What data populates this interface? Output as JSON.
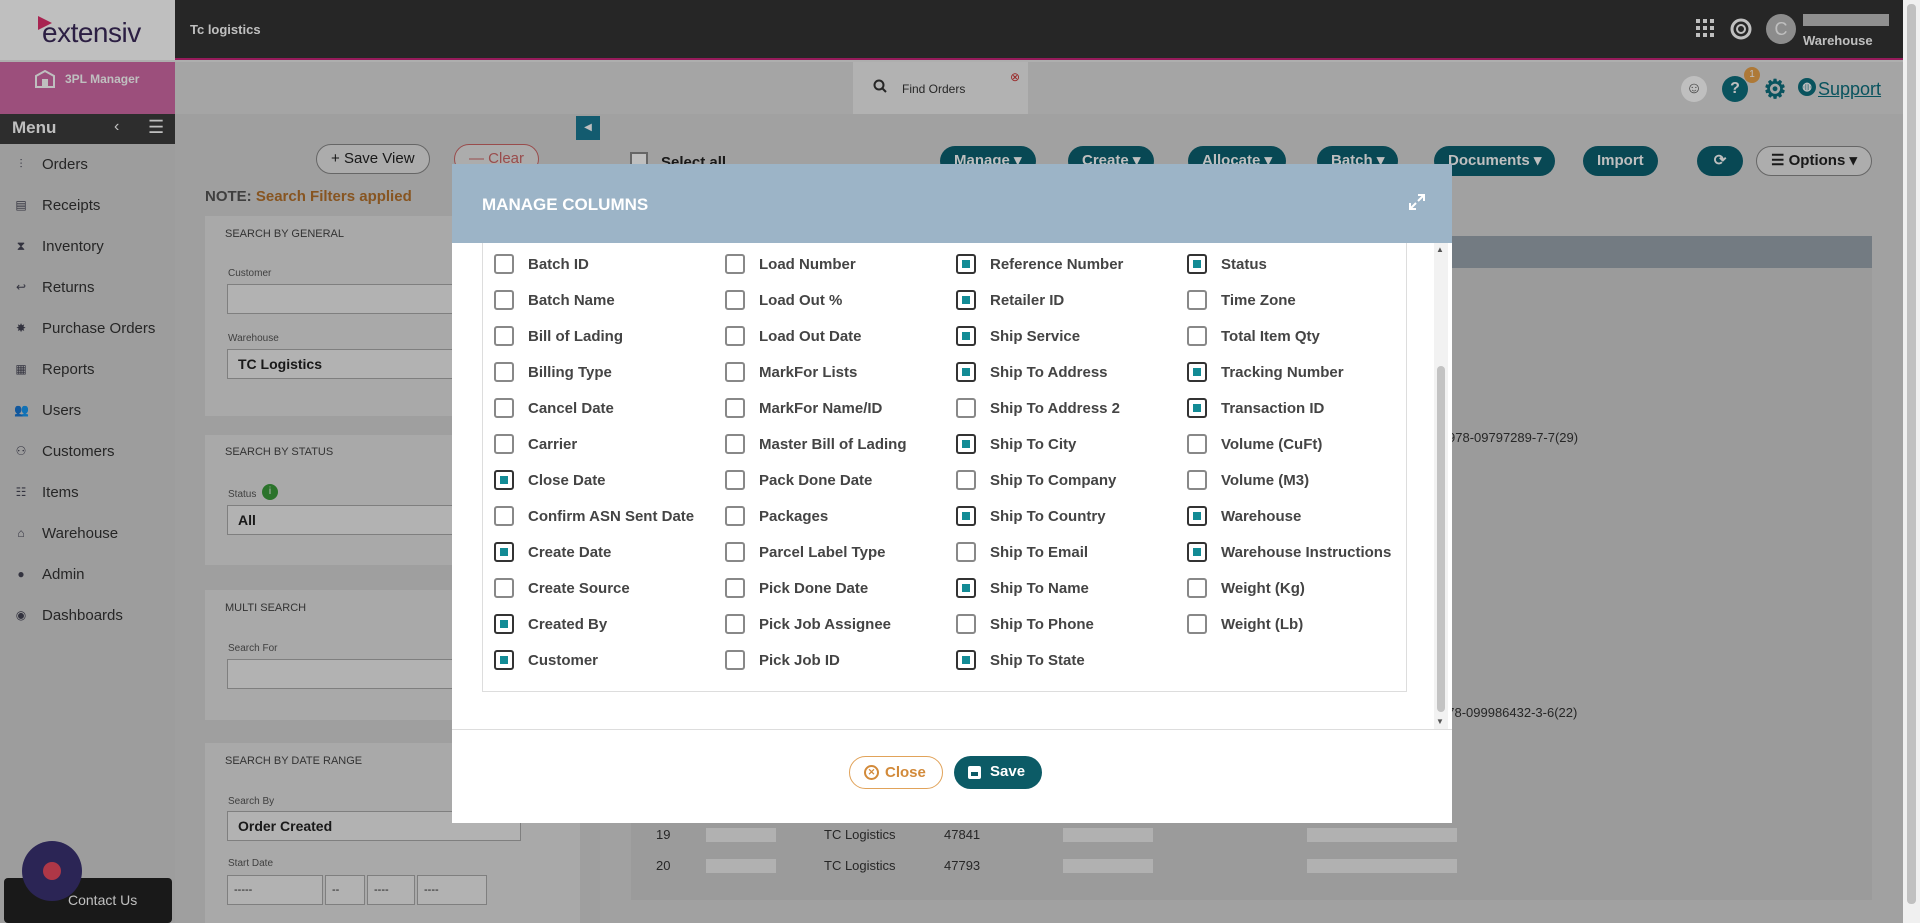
{
  "header": {
    "brand": "extensiv",
    "company": "Tc logistics",
    "user_role": "Warehouse",
    "avatar_initial": "C",
    "icons": [
      "apps-grid-icon",
      "help-wheel-icon"
    ]
  },
  "subheader": {
    "module": "3PL Manager",
    "tab_label": "Find Orders",
    "notification_count": "1",
    "support_label": "Support"
  },
  "sidebar": {
    "title": "Menu",
    "items": [
      {
        "label": "Orders",
        "icon": "orders-icon"
      },
      {
        "label": "Receipts",
        "icon": "receipt-icon"
      },
      {
        "label": "Inventory",
        "icon": "hourglass-icon"
      },
      {
        "label": "Returns",
        "icon": "return-icon"
      },
      {
        "label": "Purchase Orders",
        "icon": "purchase-order-icon"
      },
      {
        "label": "Reports",
        "icon": "reports-icon"
      },
      {
        "label": "Users",
        "icon": "users-icon"
      },
      {
        "label": "Customers",
        "icon": "customers-icon"
      },
      {
        "label": "Items",
        "icon": "items-icon"
      },
      {
        "label": "Warehouse",
        "icon": "warehouse-icon"
      },
      {
        "label": "Admin",
        "icon": "admin-icon"
      },
      {
        "label": "Dashboards",
        "icon": "dashboard-icon"
      }
    ],
    "contact_label": "Contact Us"
  },
  "filters": {
    "save_view": "Save View",
    "clear": "Clear",
    "note_prefix": "NOTE:",
    "note_text": "Search Filters applied",
    "general": {
      "title": "SEARCH BY GENERAL",
      "customer_label": "Customer",
      "warehouse_label": "Warehouse",
      "warehouse_value": "TC Logistics"
    },
    "status": {
      "title": "SEARCH BY STATUS",
      "status_label": "Status",
      "status_value": "All"
    },
    "multi": {
      "title": "MULTI SEARCH",
      "search_for_label": "Search For"
    },
    "date": {
      "title": "SEARCH BY DATE RANGE",
      "search_by_label": "Search By",
      "search_by_value": "Order Created",
      "start_label": "Start Date",
      "start_placeholders": [
        "-----",
        "--",
        "----",
        "----"
      ]
    }
  },
  "grid": {
    "select_all": "Select all",
    "toolbar": [
      "Manage",
      "Create",
      "Allocate",
      "Batch",
      "Documents",
      "Import"
    ],
    "options_label": "Options",
    "partial_ref_1": "978-09797289-7-7(29)",
    "partial_ref_2": "978-099986432-3-6(22)",
    "rows": [
      {
        "num": "19",
        "warehouse": "TC Logistics",
        "id": "47841"
      },
      {
        "num": "20",
        "warehouse": "TC Logistics",
        "id": "47793"
      }
    ]
  },
  "modal": {
    "title": "MANAGE COLUMNS",
    "columns": [
      [
        {
          "label": "Batch ID",
          "checked": false
        },
        {
          "label": "Batch Name",
          "checked": false
        },
        {
          "label": "Bill of Lading",
          "checked": false
        },
        {
          "label": "Billing Type",
          "checked": false
        },
        {
          "label": "Cancel Date",
          "checked": false
        },
        {
          "label": "Carrier",
          "checked": false
        },
        {
          "label": "Close Date",
          "checked": true
        },
        {
          "label": "Confirm ASN Sent Date",
          "checked": false
        },
        {
          "label": "Create Date",
          "checked": true
        },
        {
          "label": "Create Source",
          "checked": false
        },
        {
          "label": "Created By",
          "checked": true
        },
        {
          "label": "Customer",
          "checked": true
        }
      ],
      [
        {
          "label": "Load Number",
          "checked": false
        },
        {
          "label": "Load Out %",
          "checked": false
        },
        {
          "label": "Load Out Date",
          "checked": false
        },
        {
          "label": "MarkFor Lists",
          "checked": false
        },
        {
          "label": "MarkFor Name/ID",
          "checked": false
        },
        {
          "label": "Master Bill of Lading",
          "checked": false
        },
        {
          "label": "Pack Done Date",
          "checked": false
        },
        {
          "label": "Packages",
          "checked": false
        },
        {
          "label": "Parcel Label Type",
          "checked": false
        },
        {
          "label": "Pick Done Date",
          "checked": false
        },
        {
          "label": "Pick Job Assignee",
          "checked": false
        },
        {
          "label": "Pick Job ID",
          "checked": false
        }
      ],
      [
        {
          "label": "Reference Number",
          "checked": true
        },
        {
          "label": "Retailer ID",
          "checked": true
        },
        {
          "label": "Ship Service",
          "checked": true
        },
        {
          "label": "Ship To Address",
          "checked": true
        },
        {
          "label": "Ship To Address 2",
          "checked": false
        },
        {
          "label": "Ship To City",
          "checked": true
        },
        {
          "label": "Ship To Company",
          "checked": false
        },
        {
          "label": "Ship To Country",
          "checked": true
        },
        {
          "label": "Ship To Email",
          "checked": false
        },
        {
          "label": "Ship To Name",
          "checked": true
        },
        {
          "label": "Ship To Phone",
          "checked": false
        },
        {
          "label": "Ship To State",
          "checked": true
        }
      ],
      [
        {
          "label": "Status",
          "checked": true
        },
        {
          "label": "Time Zone",
          "checked": false
        },
        {
          "label": "Total Item Qty",
          "checked": false
        },
        {
          "label": "Tracking Number",
          "checked": true
        },
        {
          "label": "Transaction ID",
          "checked": true
        },
        {
          "label": "Volume (CuFt)",
          "checked": false
        },
        {
          "label": "Volume (M3)",
          "checked": false
        },
        {
          "label": "Warehouse",
          "checked": true
        },
        {
          "label": "Warehouse Instructions",
          "checked": true
        },
        {
          "label": "Weight (Kg)",
          "checked": false
        },
        {
          "label": "Weight (Lb)",
          "checked": false
        }
      ]
    ],
    "close_label": "Close",
    "save_label": "Save"
  },
  "colors": {
    "accent": "#0c5b66",
    "brand_pink": "#c8247a",
    "header_blue": "#9cb4c7",
    "checkbox_fill": "#128b95"
  }
}
